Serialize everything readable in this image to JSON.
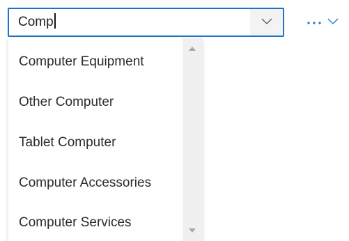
{
  "combobox": {
    "value": "Comp",
    "dropdown_icon": "chevron-down-icon"
  },
  "more_actions": {
    "icon": "ellipsis-icon",
    "chevron_icon": "chevron-down-icon"
  },
  "listbox": {
    "options": [
      {
        "label": "Computer Equipment"
      },
      {
        "label": "Other Computer"
      },
      {
        "label": "Tablet Computer"
      },
      {
        "label": "Computer Accessories"
      },
      {
        "label": "Computer Services"
      }
    ],
    "scroll_up_icon": "triangle-up-icon",
    "scroll_down_icon": "triangle-down-icon"
  },
  "colors": {
    "focus_border": "#1a73c8",
    "accent": "#1a73c8",
    "scrollbar_track": "#f0f0f0"
  }
}
